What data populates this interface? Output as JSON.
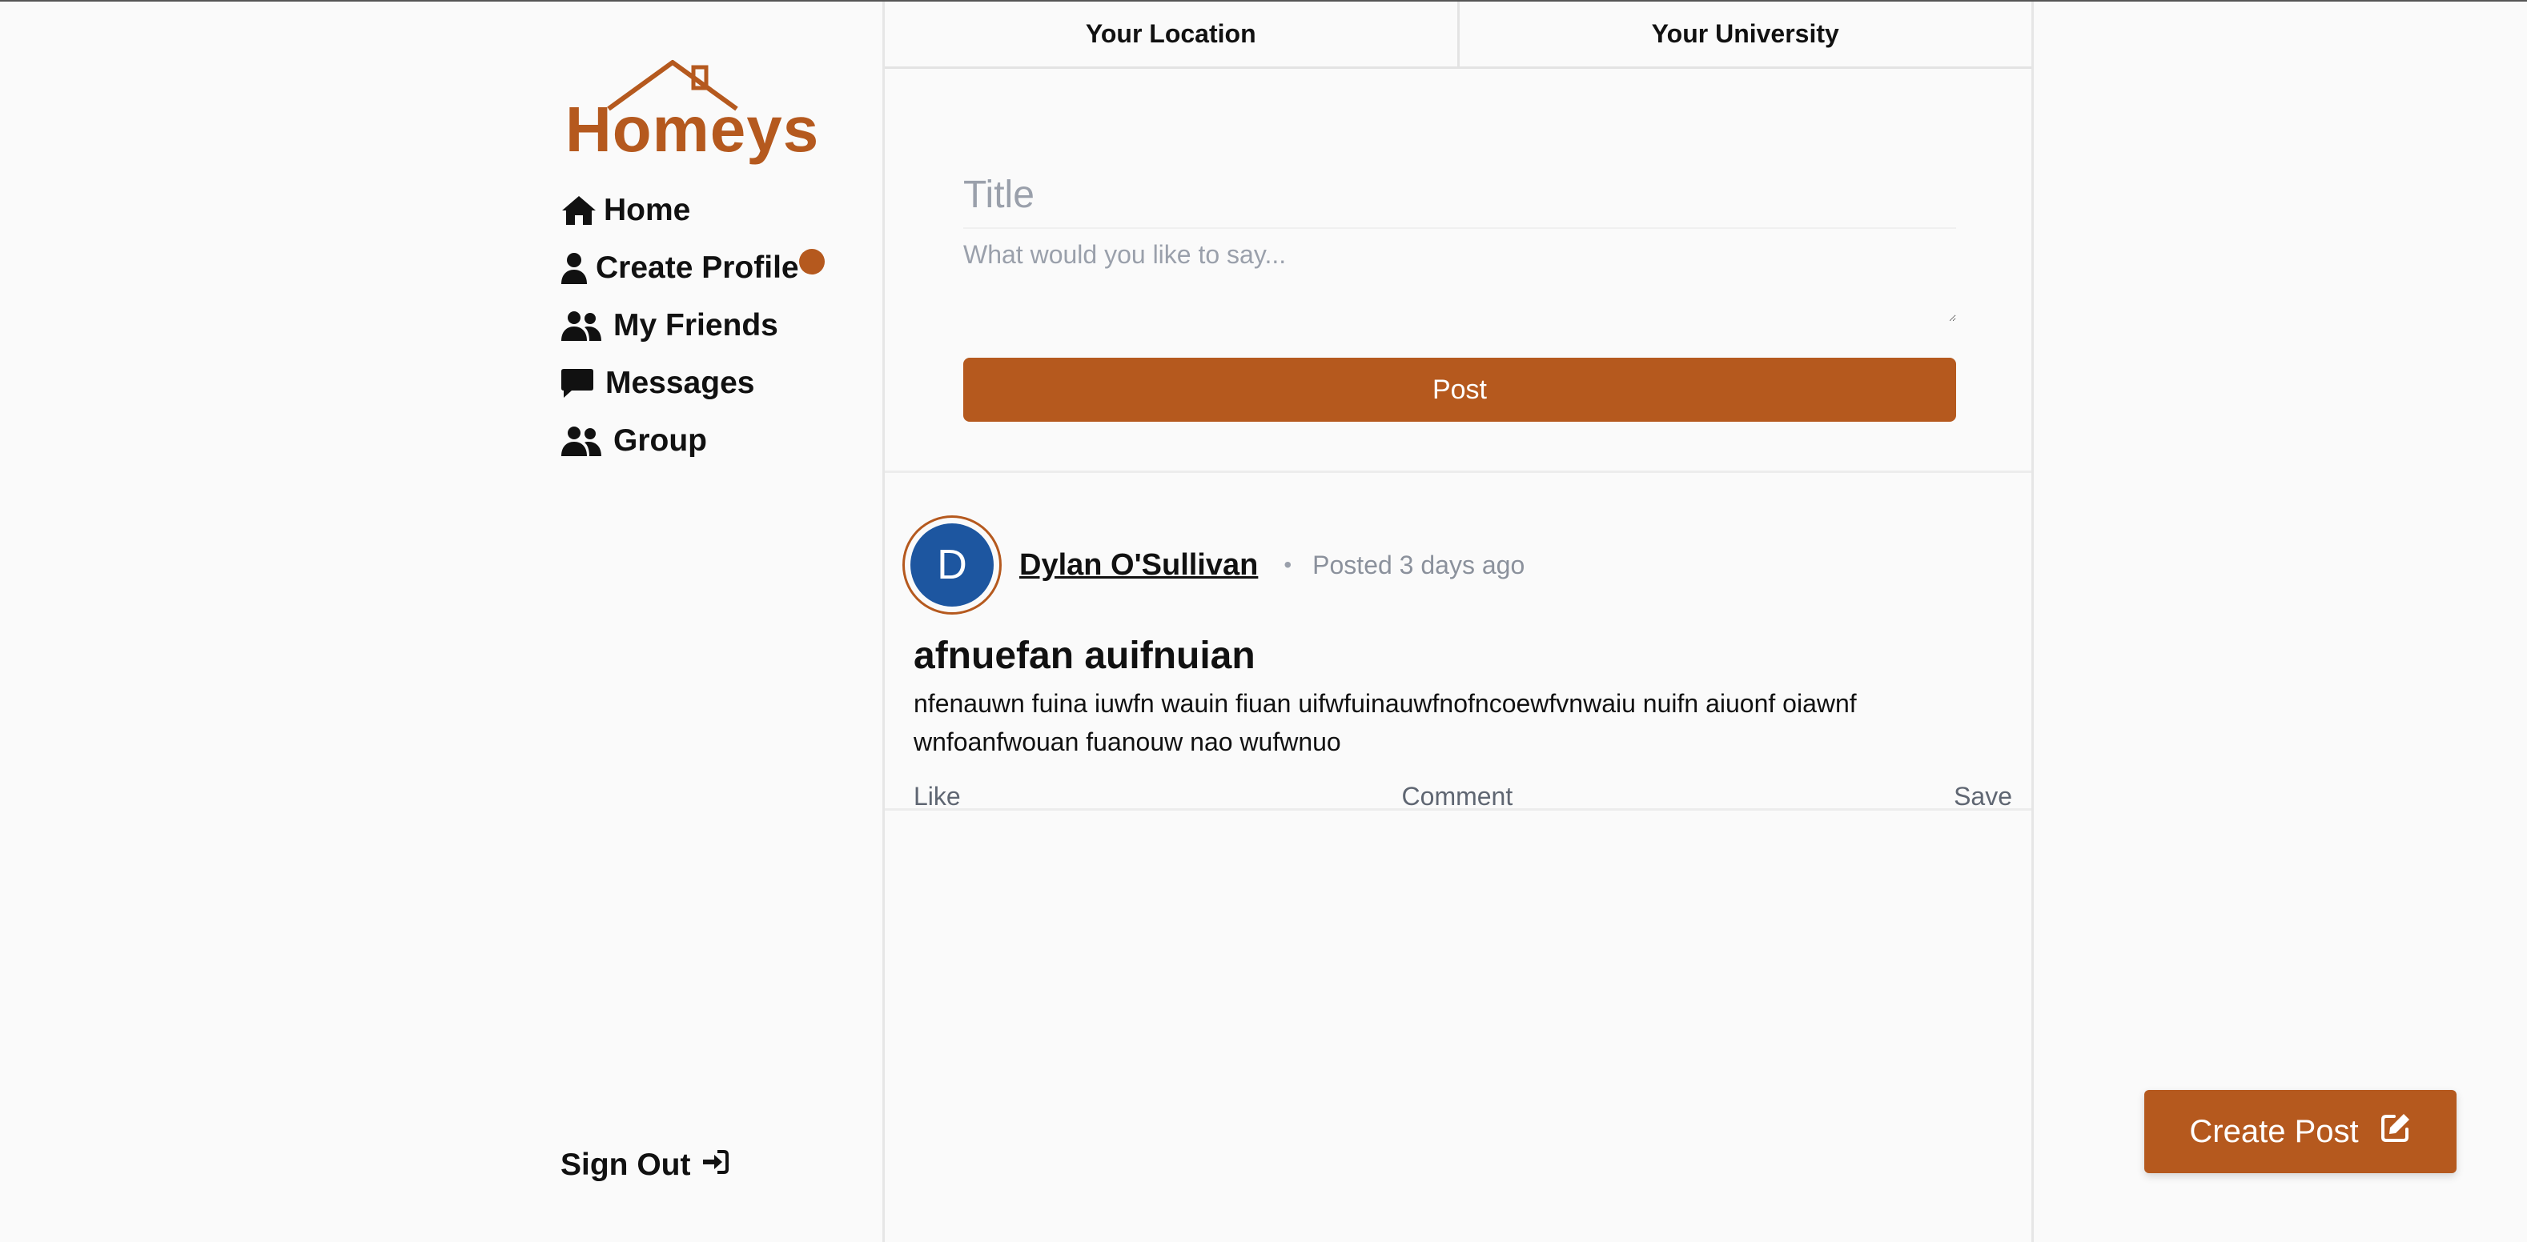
{
  "brand": {
    "name": "Homeys",
    "color": "#b5591e"
  },
  "nav": {
    "items": [
      {
        "label": "Home",
        "icon": "home-icon"
      },
      {
        "label": "Create Profile",
        "icon": "user-icon"
      },
      {
        "label": "My Friends",
        "icon": "users-icon"
      },
      {
        "label": "Messages",
        "icon": "message-icon"
      },
      {
        "label": "Group",
        "icon": "users-icon"
      }
    ],
    "signout_label": "Sign Out"
  },
  "tabs": [
    {
      "label": "Your Location"
    },
    {
      "label": "Your University"
    }
  ],
  "composer": {
    "title_placeholder": "Title",
    "body_placeholder": "What would you like to say...",
    "post_label": "Post"
  },
  "post": {
    "avatar_initial": "D",
    "author": "Dylan O'Sullivan",
    "separator": "•",
    "posted": "Posted 3 days ago",
    "title": "afnuefan auifnuian",
    "body": "nfenauwn fuina iuwfn wauin fiuan uifwfuinauwfnofncoewfvnwaiu nuifn aiuonf oiawnf wnfoanfwouan fuanouw nao wufwnuo",
    "actions": {
      "like": "Like",
      "comment": "Comment",
      "save": "Save"
    }
  },
  "create_post": {
    "label": "Create Post",
    "icon": "edit-icon"
  },
  "colors": {
    "accent": "#b5591e",
    "avatar": "#1d56a0",
    "muted": "#8b919c"
  }
}
